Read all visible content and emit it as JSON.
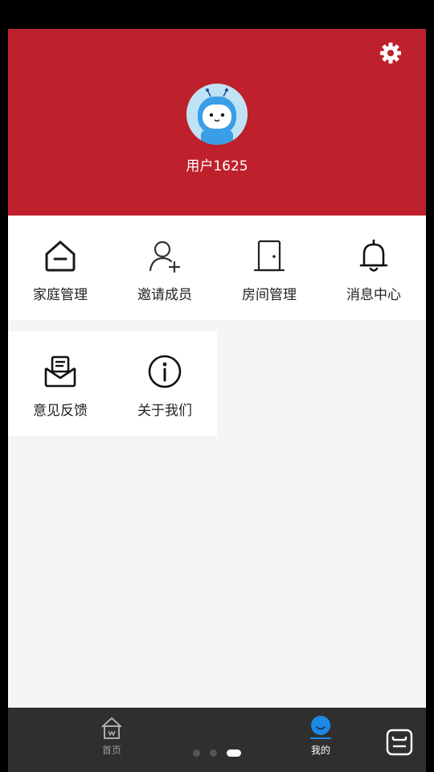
{
  "profile": {
    "username": "用户1625"
  },
  "icons": {
    "settings": "gear-icon",
    "avatar": "robot-avatar"
  },
  "menu_row1": [
    {
      "label": "家庭管理",
      "icon": "home-icon"
    },
    {
      "label": "邀请成员",
      "icon": "add-user-icon"
    },
    {
      "label": "房间管理",
      "icon": "door-icon"
    },
    {
      "label": "消息中心",
      "icon": "bell-icon"
    }
  ],
  "menu_row2": [
    {
      "label": "意见反馈",
      "icon": "feedback-mail-icon"
    },
    {
      "label": "关于我们",
      "icon": "info-icon"
    }
  ],
  "tabbar": {
    "home_label": "首页",
    "mine_label": "我的",
    "active_tab": "我的"
  },
  "colors": {
    "header": "#be212b",
    "tabbar": "#2f2f2f",
    "active_tab": "#1e88e5"
  }
}
